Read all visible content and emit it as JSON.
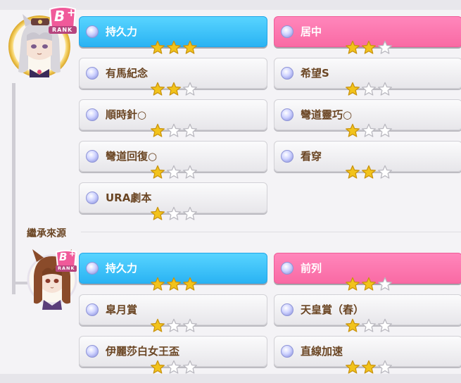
{
  "rank_text": "RANK",
  "rank_grade": "B",
  "rank_plus": "+",
  "section_title": "繼承來源",
  "star_max": 3,
  "colors": {
    "blue": "#2ab3f3",
    "pink": "#f96aa4",
    "brown_text": "#6b4624",
    "star_fill": "#f2c31b"
  },
  "main_skills": [
    {
      "label": "持久力",
      "stars": 3,
      "style": "blue"
    },
    {
      "label": "居中",
      "stars": 2,
      "style": "pink"
    },
    {
      "label": "有馬紀念",
      "stars": 2,
      "style": "gray"
    },
    {
      "label": "希望S",
      "stars": 1,
      "style": "gray"
    },
    {
      "label": "順時針○",
      "stars": 1,
      "style": "gray"
    },
    {
      "label": "彎道靈巧○",
      "stars": 1,
      "style": "gray"
    },
    {
      "label": "彎道回復○",
      "stars": 1,
      "style": "gray"
    },
    {
      "label": "看穿",
      "stars": 2,
      "style": "gray"
    },
    {
      "label": "URA劇本",
      "stars": 1,
      "style": "gray"
    }
  ],
  "parent_skills": [
    {
      "label": "持久力",
      "stars": 3,
      "style": "blue"
    },
    {
      "label": "前列",
      "stars": 2,
      "style": "pink"
    },
    {
      "label": "皐月賞",
      "stars": 1,
      "style": "gray"
    },
    {
      "label": "天皇賞（春）",
      "stars": 1,
      "style": "gray"
    },
    {
      "label": "伊麗莎白女王盃",
      "stars": 1,
      "style": "gray"
    },
    {
      "label": "直線加速",
      "stars": 2,
      "style": "gray"
    }
  ]
}
